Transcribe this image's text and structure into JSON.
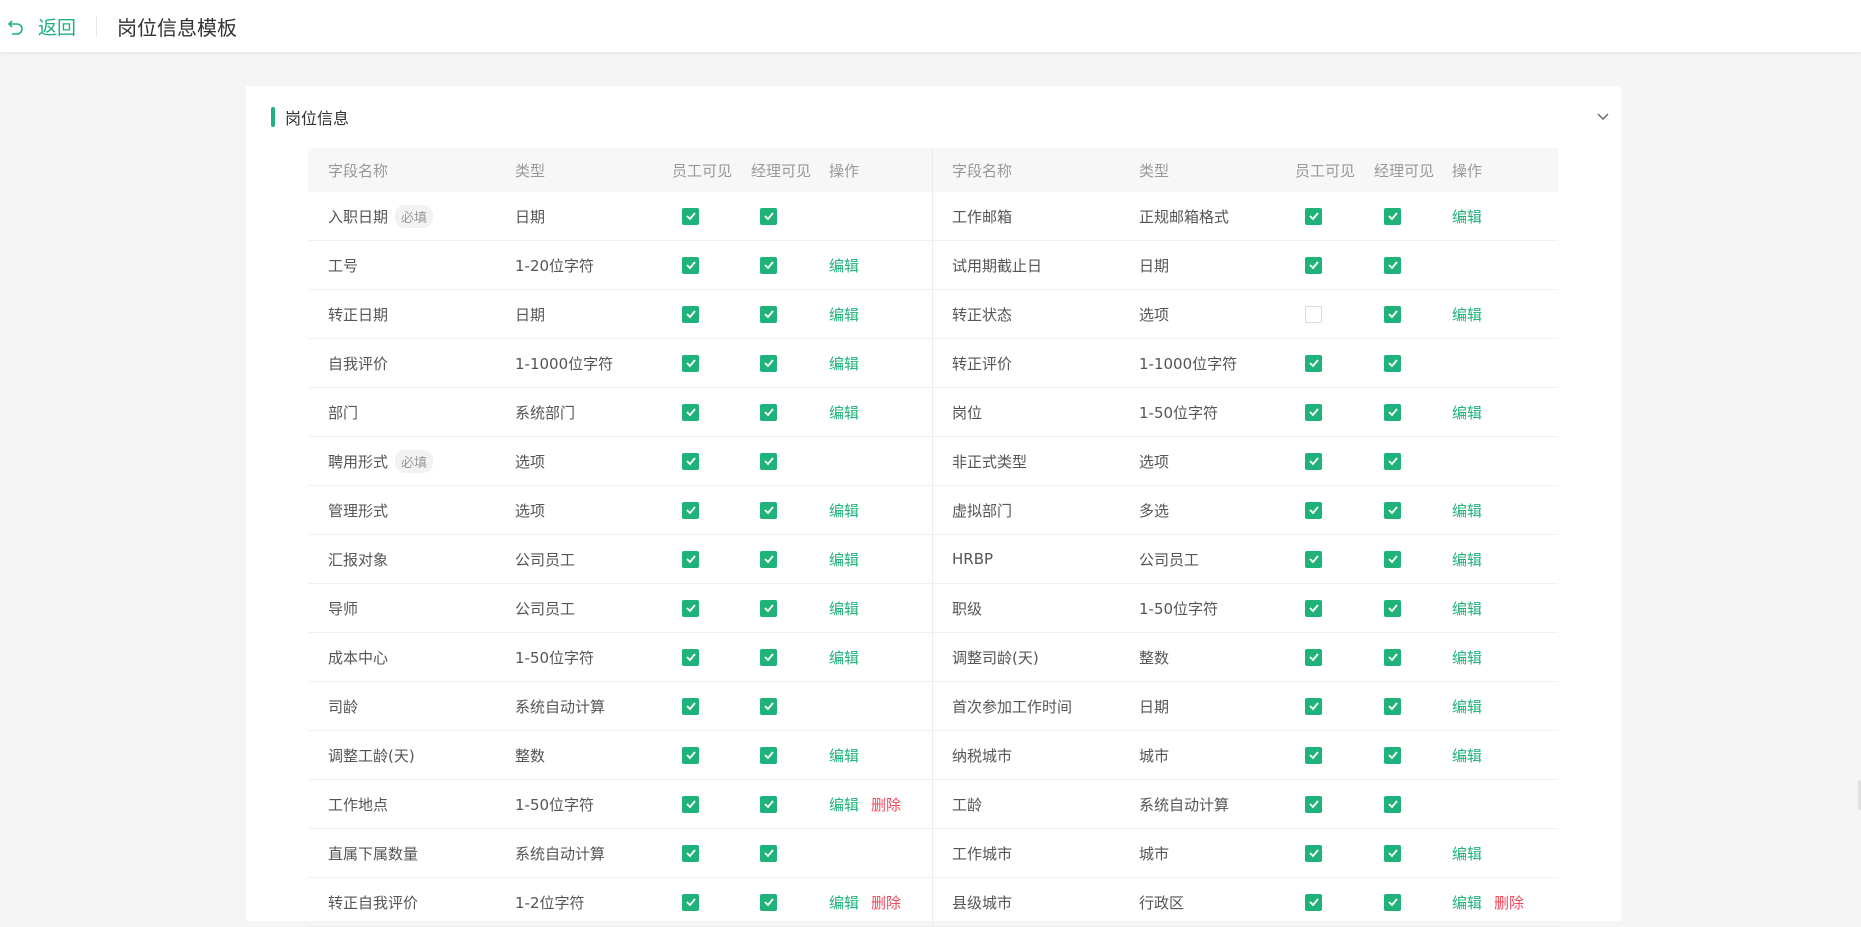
{
  "header": {
    "back_label": "返回",
    "title": "岗位信息模板"
  },
  "section": {
    "title": "岗位信息"
  },
  "columns": {
    "name": "字段名称",
    "type": "类型",
    "employee_visible": "员工可见",
    "manager_visible": "经理可见",
    "action": "操作"
  },
  "labels": {
    "required": "必填",
    "edit": "编辑",
    "delete": "删除"
  },
  "colors": {
    "accent": "#1fb27a",
    "danger": "#f5495a"
  },
  "left_rows": [
    {
      "name": "入职日期",
      "required": true,
      "type": "日期",
      "emp": true,
      "mgr": true,
      "edit": false,
      "del": false
    },
    {
      "name": "工号",
      "required": false,
      "type": "1-20位字符",
      "emp": true,
      "mgr": true,
      "edit": true,
      "del": false
    },
    {
      "name": "转正日期",
      "required": false,
      "type": "日期",
      "emp": true,
      "mgr": true,
      "edit": true,
      "del": false
    },
    {
      "name": "自我评价",
      "required": false,
      "type": "1-1000位字符",
      "emp": true,
      "mgr": true,
      "edit": true,
      "del": false
    },
    {
      "name": "部门",
      "required": false,
      "type": "系统部门",
      "emp": true,
      "mgr": true,
      "edit": true,
      "del": false
    },
    {
      "name": "聘用形式",
      "required": true,
      "type": "选项",
      "emp": true,
      "mgr": true,
      "edit": false,
      "del": false
    },
    {
      "name": "管理形式",
      "required": false,
      "type": "选项",
      "emp": true,
      "mgr": true,
      "edit": true,
      "del": false
    },
    {
      "name": "汇报对象",
      "required": false,
      "type": "公司员工",
      "emp": true,
      "mgr": true,
      "edit": true,
      "del": false
    },
    {
      "name": "导师",
      "required": false,
      "type": "公司员工",
      "emp": true,
      "mgr": true,
      "edit": true,
      "del": false
    },
    {
      "name": "成本中心",
      "required": false,
      "type": "1-50位字符",
      "emp": true,
      "mgr": true,
      "edit": true,
      "del": false
    },
    {
      "name": "司龄",
      "required": false,
      "type": "系统自动计算",
      "emp": true,
      "mgr": true,
      "edit": false,
      "del": false
    },
    {
      "name": "调整工龄(天)",
      "required": false,
      "type": "整数",
      "emp": true,
      "mgr": true,
      "edit": true,
      "del": false
    },
    {
      "name": "工作地点",
      "required": false,
      "type": "1-50位字符",
      "emp": true,
      "mgr": true,
      "edit": true,
      "del": true
    },
    {
      "name": "直属下属数量",
      "required": false,
      "type": "系统自动计算",
      "emp": true,
      "mgr": true,
      "edit": false,
      "del": false
    },
    {
      "name": "转正自我评价",
      "required": false,
      "type": "1-2位字符",
      "emp": true,
      "mgr": true,
      "edit": true,
      "del": true
    }
  ],
  "right_rows": [
    {
      "name": "工作邮箱",
      "required": false,
      "type": "正规邮箱格式",
      "emp": true,
      "mgr": true,
      "edit": true,
      "del": false
    },
    {
      "name": "试用期截止日",
      "required": false,
      "type": "日期",
      "emp": true,
      "mgr": true,
      "edit": false,
      "del": false
    },
    {
      "name": "转正状态",
      "required": false,
      "type": "选项",
      "emp": false,
      "mgr": true,
      "edit": true,
      "del": false
    },
    {
      "name": "转正评价",
      "required": false,
      "type": "1-1000位字符",
      "emp": true,
      "mgr": true,
      "edit": false,
      "del": false
    },
    {
      "name": "岗位",
      "required": false,
      "type": "1-50位字符",
      "emp": true,
      "mgr": true,
      "edit": true,
      "del": false
    },
    {
      "name": "非正式类型",
      "required": false,
      "type": "选项",
      "emp": true,
      "mgr": true,
      "edit": false,
      "del": false
    },
    {
      "name": "虚拟部门",
      "required": false,
      "type": "多选",
      "emp": true,
      "mgr": true,
      "edit": true,
      "del": false
    },
    {
      "name": "HRBP",
      "required": false,
      "type": "公司员工",
      "emp": true,
      "mgr": true,
      "edit": true,
      "del": false
    },
    {
      "name": "职级",
      "required": false,
      "type": "1-50位字符",
      "emp": true,
      "mgr": true,
      "edit": true,
      "del": false
    },
    {
      "name": "调整司龄(天)",
      "required": false,
      "type": "整数",
      "emp": true,
      "mgr": true,
      "edit": true,
      "del": false
    },
    {
      "name": "首次参加工作时间",
      "required": false,
      "type": "日期",
      "emp": true,
      "mgr": true,
      "edit": true,
      "del": false
    },
    {
      "name": "纳税城市",
      "required": false,
      "type": "城市",
      "emp": true,
      "mgr": true,
      "edit": true,
      "del": false
    },
    {
      "name": "工龄",
      "required": false,
      "type": "系统自动计算",
      "emp": true,
      "mgr": true,
      "edit": false,
      "del": false
    },
    {
      "name": "工作城市",
      "required": false,
      "type": "城市",
      "emp": true,
      "mgr": true,
      "edit": true,
      "del": false
    },
    {
      "name": "县级城市",
      "required": false,
      "type": "行政区",
      "emp": true,
      "mgr": true,
      "edit": true,
      "del": true
    }
  ]
}
